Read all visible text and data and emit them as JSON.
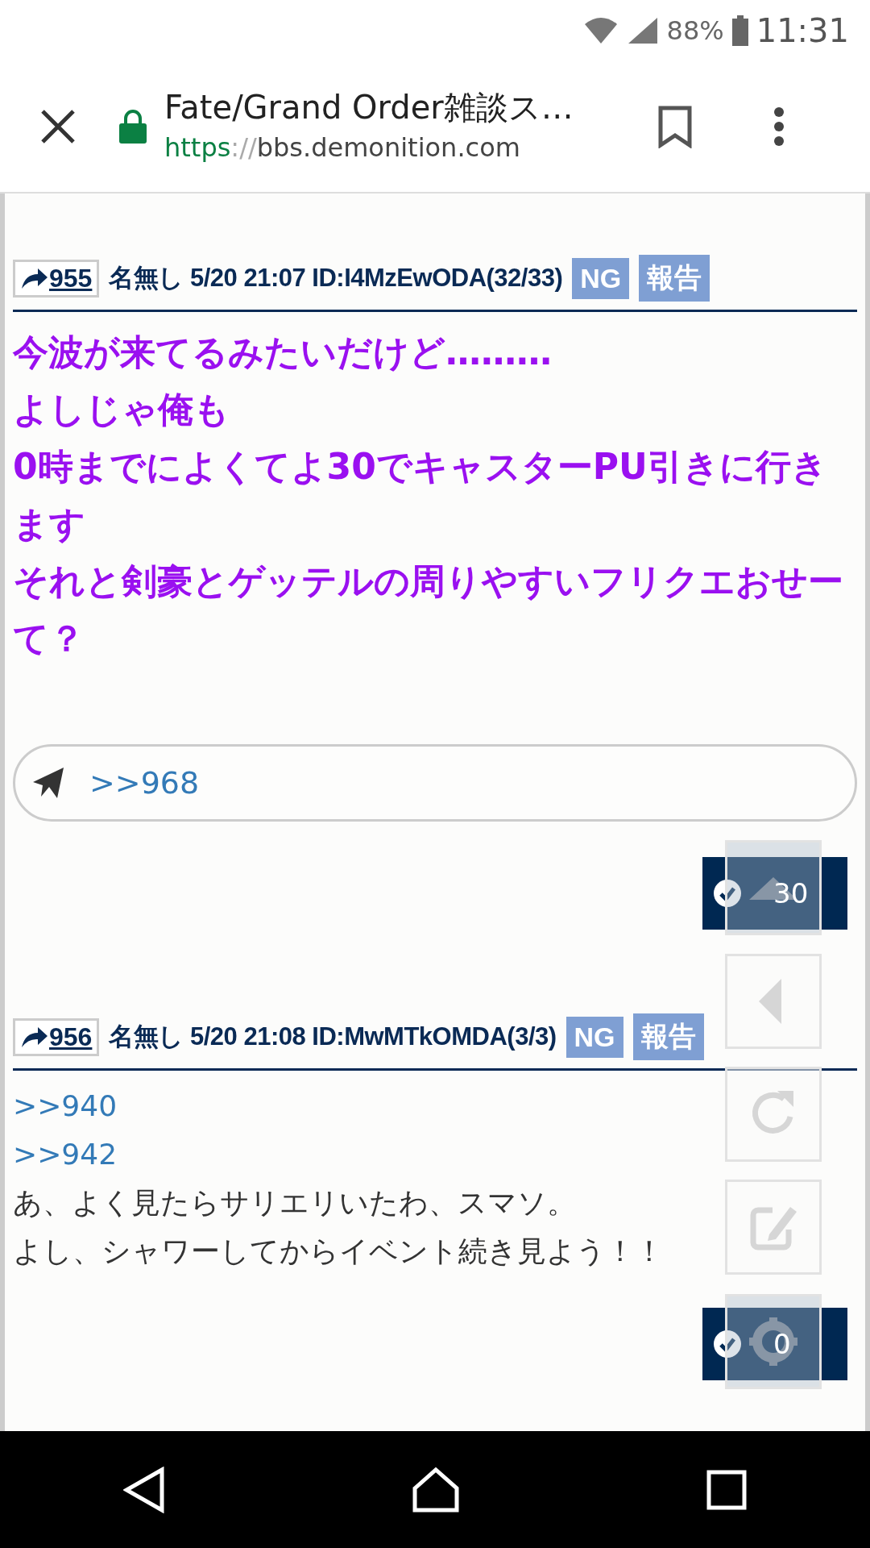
{
  "status_bar": {
    "battery": "88%",
    "time": "11:31"
  },
  "browser": {
    "title": "Fate/Grand Order雑談ス…",
    "url_scheme": "https",
    "url_separator": "://",
    "url_host": "bbs.demonition.com"
  },
  "posts": [
    {
      "number": "955",
      "name": "名無し",
      "date": "5/20",
      "time": "21:07",
      "id": "ID:I4MzEwODA(32/33)",
      "ng_label": "NG",
      "report_label": "報告",
      "lines": [
        {
          "kind": "emphasis",
          "text": "今波が来てるみたいだけど………"
        },
        {
          "kind": "emphasis",
          "text": "よしじゃ俺も"
        },
        {
          "kind": "emphasis",
          "text": "0時までによくてよ30でキャスターPU引きに行きます"
        },
        {
          "kind": "emphasis",
          "text": "それと剣豪とゲッテルの周りやすいフリクエおせーて？"
        }
      ],
      "reply": ">>968",
      "likes": "30"
    },
    {
      "number": "956",
      "name": "名無し",
      "date": "5/20",
      "time": "21:08",
      "id": "ID:MwMTkOMDA(3/3)",
      "ng_label": "NG",
      "report_label": "報告",
      "lines": [
        {
          "kind": "link",
          "text": ">>940"
        },
        {
          "kind": "link",
          "text": ">>942"
        },
        {
          "kind": "text",
          "text": "あ、よく見たらサリエリいたわ、スマソ。"
        },
        {
          "kind": "text",
          "text": "よし、シャワーしてからイベント続き見よう！！"
        }
      ],
      "likes": "0"
    }
  ]
}
